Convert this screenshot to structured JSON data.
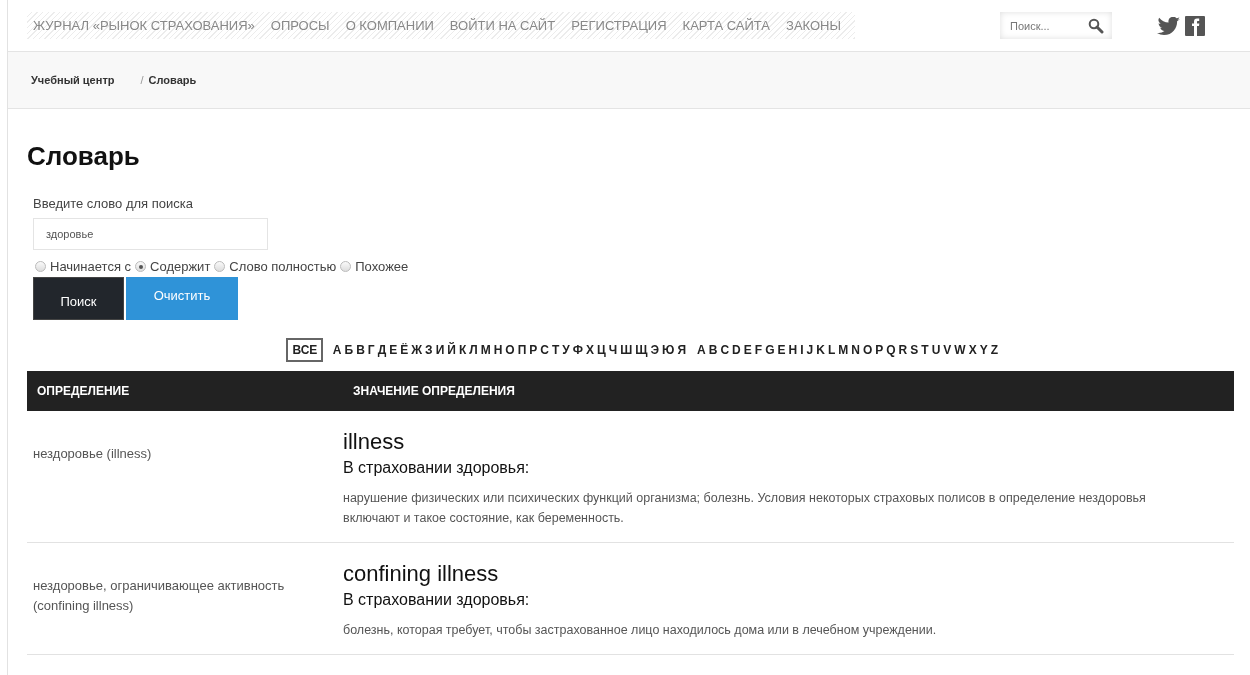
{
  "nav": {
    "items": [
      "ЖУРНАЛ «РЫНОК СТРАХОВАНИЯ»",
      "ОПРОСЫ",
      "О КОМПАНИИ",
      "ВОЙТИ НА САЙТ",
      "РЕГИСТРАЦИЯ",
      "КАРТА САЙТА",
      "ЗАКОНЫ"
    ],
    "search": {
      "placeholder": "Поиск..."
    }
  },
  "breadcrumbs": [
    "Учебный центр",
    "Словарь"
  ],
  "breadcrumb_separator": "/",
  "page_title": "Словарь",
  "search_form": {
    "label": "Введите слово для поиска",
    "value": "здоровье",
    "modes": [
      {
        "label": "Начинается с",
        "selected": false
      },
      {
        "label": "Содержит",
        "selected": true
      },
      {
        "label": "Слово полностью",
        "selected": false
      },
      {
        "label": "Похожее",
        "selected": false
      }
    ],
    "buttons": [
      {
        "label": "Поиск",
        "kind": "primary"
      },
      {
        "label": "Очистить",
        "kind": "secondary"
      }
    ]
  },
  "alphabet": [
    [
      {
        "label": "ВСЕ",
        "selected": true
      }
    ],
    [
      {
        "label": "А",
        "selected": false
      },
      {
        "label": "Б",
        "selected": false
      },
      {
        "label": "В",
        "selected": false
      },
      {
        "label": "Г",
        "selected": false
      },
      {
        "label": "Д",
        "selected": false
      },
      {
        "label": "Е",
        "selected": false
      },
      {
        "label": "Ё",
        "selected": false
      },
      {
        "label": "Ж",
        "selected": false
      },
      {
        "label": "З",
        "selected": false
      },
      {
        "label": "И",
        "selected": false
      },
      {
        "label": "Й",
        "selected": false
      },
      {
        "label": "К",
        "selected": false
      },
      {
        "label": "Л",
        "selected": false
      },
      {
        "label": "М",
        "selected": false
      },
      {
        "label": "Н",
        "selected": false
      },
      {
        "label": "О",
        "selected": false
      },
      {
        "label": "П",
        "selected": false
      },
      {
        "label": "Р",
        "selected": false
      },
      {
        "label": "С",
        "selected": false
      },
      {
        "label": "Т",
        "selected": false
      },
      {
        "label": "У",
        "selected": false
      },
      {
        "label": "Ф",
        "selected": false
      },
      {
        "label": "Х",
        "selected": false
      },
      {
        "label": "Ц",
        "selected": false
      },
      {
        "label": "Ч",
        "selected": false
      },
      {
        "label": "Ш",
        "selected": false
      },
      {
        "label": "Щ",
        "selected": false
      },
      {
        "label": "Э",
        "selected": false
      },
      {
        "label": "Ю",
        "selected": false
      },
      {
        "label": "Я",
        "selected": false
      }
    ],
    [
      {
        "label": "A",
        "selected": false
      },
      {
        "label": "B",
        "selected": false
      },
      {
        "label": "C",
        "selected": false
      },
      {
        "label": "D",
        "selected": false
      },
      {
        "label": "E",
        "selected": false
      },
      {
        "label": "F",
        "selected": false
      },
      {
        "label": "G",
        "selected": false
      },
      {
        "label": "E",
        "selected": false
      },
      {
        "label": "H",
        "selected": false
      },
      {
        "label": "I",
        "selected": false
      },
      {
        "label": "J",
        "selected": false
      },
      {
        "label": "K",
        "selected": false
      },
      {
        "label": "L",
        "selected": false
      },
      {
        "label": "M",
        "selected": false
      },
      {
        "label": "N",
        "selected": false
      },
      {
        "label": "O",
        "selected": false
      },
      {
        "label": "P",
        "selected": false
      },
      {
        "label": "Q",
        "selected": false
      },
      {
        "label": "R",
        "selected": false
      },
      {
        "label": "S",
        "selected": false
      },
      {
        "label": "T",
        "selected": false
      },
      {
        "label": "U",
        "selected": false
      },
      {
        "label": "V",
        "selected": false
      },
      {
        "label": "W",
        "selected": false
      },
      {
        "label": "X",
        "selected": false
      },
      {
        "label": "Y",
        "selected": false
      },
      {
        "label": "Z",
        "selected": false
      }
    ]
  ],
  "table": {
    "columns": [
      "ОПРЕДЕЛЕНИЕ",
      "ЗНАЧЕНИЕ ОПРЕДЕЛЕНИЯ"
    ],
    "rows": [
      {
        "term": "нездоровье (illness)",
        "headword": "illness",
        "field": "В страховании здоровья:",
        "definition": "нарушение физических или психических функций организма; болезнь. Условия некоторых страховых полисов в определение нездоровья включают и такое состояние, как беременность."
      },
      {
        "term": "нездоровье, ограничивающее активность (confining illness)",
        "headword": "confining illness",
        "field": "В страховании здоровья:",
        "definition": "болезнь, которая требует, чтобы застрахованное лицо находилось дома или в лечебном учреждении."
      }
    ]
  }
}
